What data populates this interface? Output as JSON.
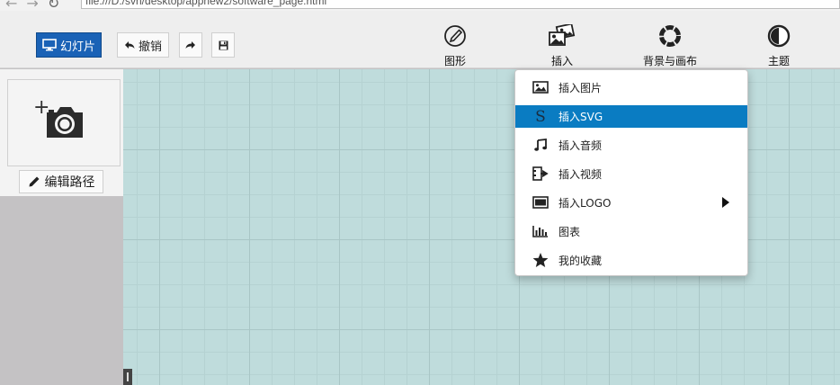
{
  "browser": {
    "address": "file:///D:/svn/desktop/appnew2/software_page.html"
  },
  "toolbar": {
    "slides_label": "幻灯片",
    "undo_label": "撤销",
    "tools": [
      {
        "label": "图形",
        "icon": "compass-icon"
      },
      {
        "label": "插入",
        "icon": "images-icon"
      },
      {
        "label": "背景与画布",
        "icon": "ring-icon"
      },
      {
        "label": "主题",
        "icon": "contrast-icon"
      }
    ]
  },
  "left_panel": {
    "edit_path_label": "编辑路径"
  },
  "insert_menu": {
    "items": [
      {
        "label": "插入图片",
        "icon": "image-icon"
      },
      {
        "label": "插入SVG",
        "icon": "svg-s-icon"
      },
      {
        "label": "插入音频",
        "icon": "music-note-icon"
      },
      {
        "label": "插入视频",
        "icon": "video-icon"
      },
      {
        "label": "插入LOGO",
        "icon": "logo-rect-icon"
      },
      {
        "label": "图表",
        "icon": "bar-chart-icon"
      },
      {
        "label": "我的收藏",
        "icon": "star-icon"
      }
    ],
    "active_index": 1
  },
  "colors": {
    "accent": "#1a62b6",
    "menu_highlight": "#0a7cc2",
    "canvas_bg": "#bfdcdc"
  }
}
